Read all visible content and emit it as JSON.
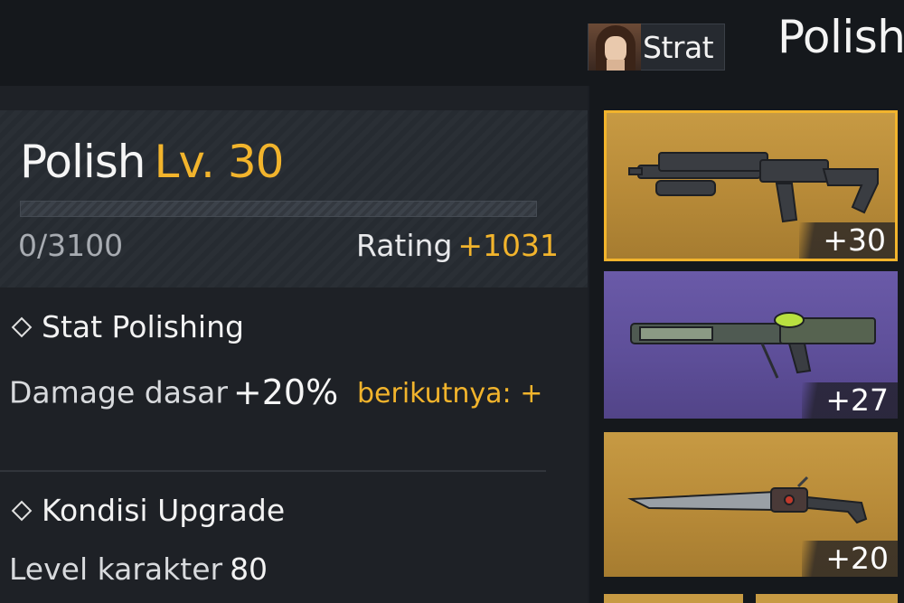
{
  "header": {
    "character_name": "Strat",
    "page_title": "Polish"
  },
  "polish": {
    "name": "Polish",
    "level_label": "Lv. 30",
    "xp": "0/3100",
    "xp_progress": 0,
    "rating_label": "Rating",
    "rating_value": "+1031"
  },
  "stat_polishing": {
    "title": "Stat Polishing",
    "label": "Damage dasar",
    "value": "+20%",
    "next": "berikutnya: +"
  },
  "upgrade_condition": {
    "title": "Kondisi Upgrade",
    "label": "Level karakter",
    "value": "80"
  },
  "weapons": [
    {
      "badge": "+30",
      "rarity": "gold",
      "selected": true,
      "icon": "smg-icon"
    },
    {
      "badge": "+27",
      "rarity": "purple",
      "selected": false,
      "icon": "rifle-icon"
    },
    {
      "badge": "+20",
      "rarity": "gold",
      "selected": false,
      "icon": "blade-icon"
    }
  ],
  "colors": {
    "accent": "#f2b42c",
    "gold_card": "#c79a43",
    "purple_card": "#6a5aa8",
    "background": "#1b1e24"
  }
}
